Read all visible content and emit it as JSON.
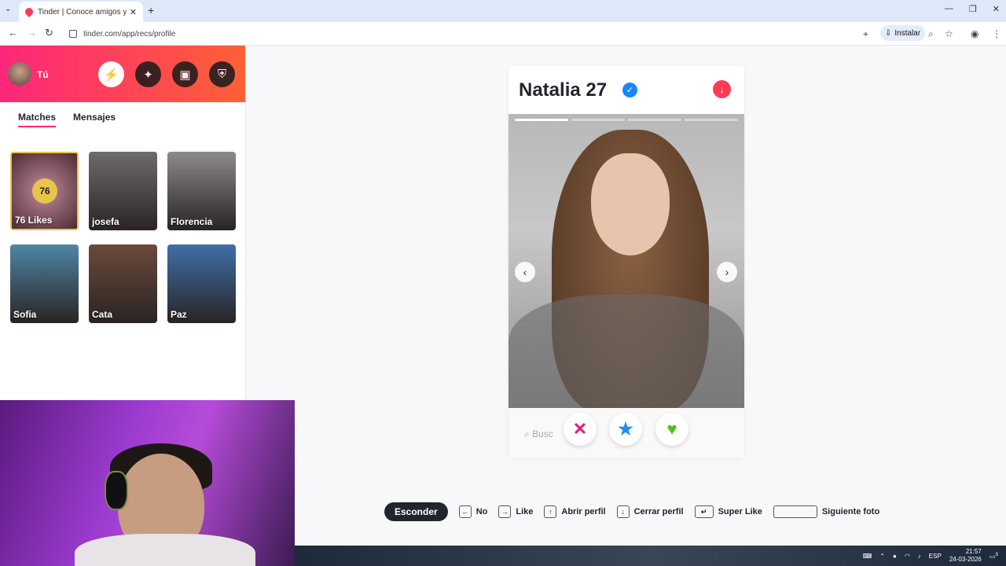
{
  "browser": {
    "tab_title": "Tinder | Conoce amigos y gente",
    "url": "tinder.com/app/recs/profile",
    "install_label": "Instalar"
  },
  "sidebar": {
    "me_label": "Tú",
    "tabs": [
      "Matches",
      "Mensajes"
    ],
    "likes_count": "76",
    "likes_label": "76 Likes",
    "matches": [
      {
        "name": "josefa",
        "color": "#6f6a6c"
      },
      {
        "name": "Florencia",
        "color": "#8e8a8a"
      },
      {
        "name": "Sofia",
        "color": "#4f86a6"
      },
      {
        "name": "Cata",
        "color": "#6a4a3a"
      },
      {
        "name": "Paz",
        "color": "#3f6fa8"
      }
    ]
  },
  "profile": {
    "name_age": "Natalia 27",
    "photo_count": 4,
    "current_photo": 1,
    "search_placeholder": "Busc"
  },
  "actions": {
    "nope_icon": "✕",
    "superlike_icon": "★",
    "like_icon": "♥"
  },
  "shortcuts": {
    "hide": "Esconder",
    "items": [
      {
        "key": "←",
        "label": "No"
      },
      {
        "key": "→",
        "label": "Like"
      },
      {
        "key": "↑",
        "label": "Abrir perfil"
      },
      {
        "key": "↓",
        "label": "Cerrar perfil"
      },
      {
        "key": "↵",
        "label": "Super Like"
      },
      {
        "key": "",
        "label": "Siguiente foto"
      }
    ]
  },
  "system": {
    "lang": "ESP",
    "time": "21:57",
    "date": "24-03-2026",
    "notif_count": "3"
  }
}
